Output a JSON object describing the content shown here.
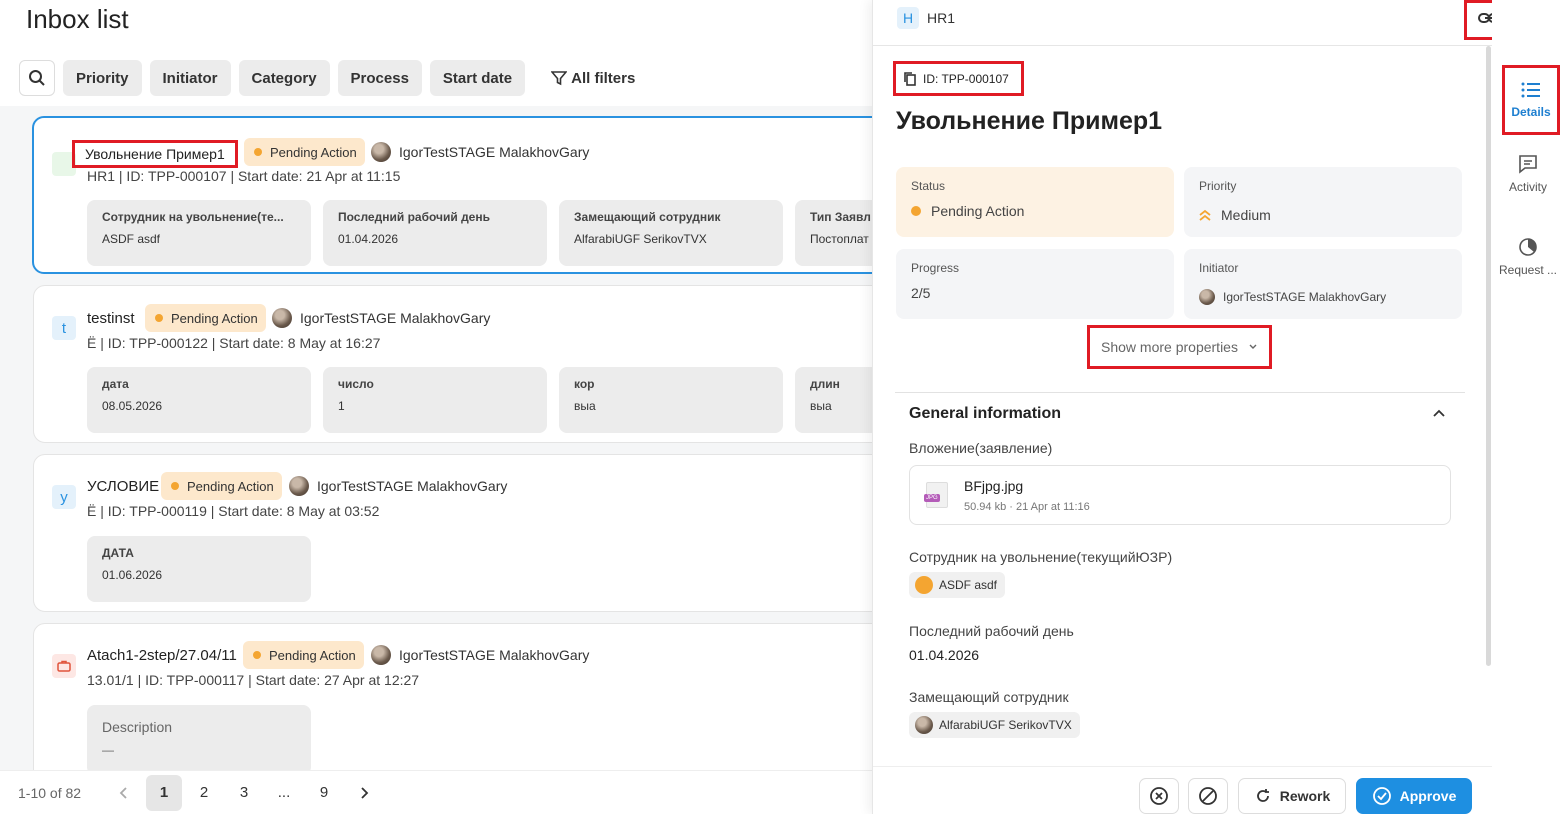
{
  "page": {
    "title": "Inbox list"
  },
  "filters": {
    "chips": [
      "Priority",
      "Initiator",
      "Category",
      "Process",
      "Start date"
    ],
    "all_filters": "All filters"
  },
  "cards": [
    {
      "letter": "",
      "title": "Увольнение Пример1",
      "status": "Pending Action",
      "user": "IgorTestSTAGE MalakhovGary",
      "meta": "HR1 |  ID: TPP-000107  | Start date: 21 Apr at 11:15",
      "fields": [
        {
          "label": "Сотрудник на увольнение(те...",
          "value": "ASDF asdf"
        },
        {
          "label": "Последний рабочий день",
          "value": "01.04.2026"
        },
        {
          "label": "Замещающий сотрудник",
          "value": "AlfarabiUGF SerikovTVX"
        },
        {
          "label": "Тип Заявл",
          "value": "Постоплат"
        }
      ]
    },
    {
      "letter": "t",
      "title": "testinst",
      "status": "Pending Action",
      "user": "IgorTestSTAGE MalakhovGary",
      "meta": "Ё |  ID: TPP-000122  | Start date: 8 May at 16:27",
      "fields": [
        {
          "label": "дата",
          "value": "08.05.2026"
        },
        {
          "label": "число",
          "value": "1"
        },
        {
          "label": "кор",
          "value": "выа"
        },
        {
          "label": "длин",
          "value": "выа"
        }
      ]
    },
    {
      "letter": "у",
      "title": "УСЛОВИЕ",
      "status": "Pending Action",
      "user": "IgorTestSTAGE MalakhovGary",
      "meta": "Ё |  ID: TPP-000119  | Start date: 8 May at 03:52",
      "fields": [
        {
          "label": "ДАТА",
          "value": "01.06.2026"
        }
      ]
    },
    {
      "letter": "",
      "title": "Atach1-2step/27.04/11",
      "status": "Pending Action",
      "user": "IgorTestSTAGE MalakhovGary",
      "meta": "13.01/1 |  ID: TPP-000117  | Start date: 27 Apr at 12:27",
      "fields": [
        {
          "label": "Description",
          "value": "—"
        }
      ]
    }
  ],
  "pager": {
    "count": "1-10 of 82",
    "pages": [
      "1",
      "2",
      "3",
      "...",
      "9"
    ],
    "current": "1"
  },
  "panel": {
    "hr_letter": "H",
    "hr_label": "HR1",
    "id_tag": "ID: TPP-000107",
    "title": "Увольнение Пример1",
    "props": {
      "status_label": "Status",
      "status_value": "Pending Action",
      "priority_label": "Priority",
      "priority_value": "Medium",
      "progress_label": "Progress",
      "progress_value": "2/5",
      "initiator_label": "Initiator",
      "initiator_value": "IgorTestSTAGE MalakhovGary"
    },
    "show_more": "Show more properties",
    "general": {
      "title": "General information",
      "attachment_label": "Вложение(заявление)",
      "file_name": "BFjpg.jpg",
      "file_meta": "50.94 kb · 21 Apr at 11:16",
      "file_type": "JPG",
      "employee_label": "Сотрудник на увольнение(текущийЮЗР)",
      "employee_value": "ASDF asdf",
      "last_day_label": "Последний рабочий день",
      "last_day_value": "01.04.2026",
      "replacement_label": "Замещающий сотрудник",
      "replacement_value": "AlfarabiUGF SerikovTVX"
    },
    "footer": {
      "rework": "Rework",
      "approve": "Approve"
    }
  },
  "rail": {
    "details": "Details",
    "activity": "Activity",
    "request": "Request ..."
  },
  "colors": {
    "accent": "#1e8fe1",
    "pending": "#f4a531",
    "highlight": "#e01b24"
  }
}
